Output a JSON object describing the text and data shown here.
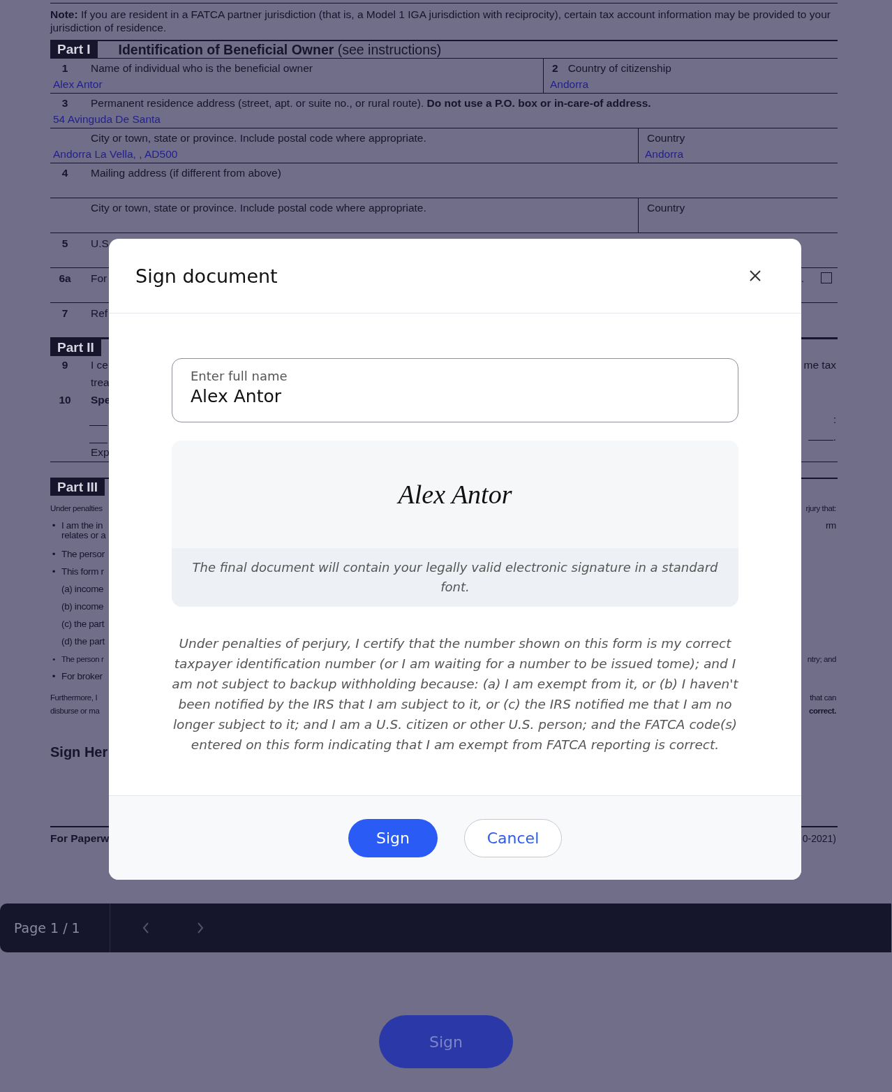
{
  "note": "**Note:** If you are resident in a FATCA partner jurisdiction (that is, a Model 1 IGA jurisdiction with reciprocity), certain tax account information may be provided to your jurisdiction of residence.",
  "part_one": {
    "label": "Part I",
    "title": "**Identification of Beneficial Owner** (see instructions)"
  },
  "rows": [
    {
      "kind": "split",
      "cells": [
        {
          "number": "1",
          "label": "Name of individual who is the beneficial owner",
          "value": "Alex Antor"
        },
        {
          "number": "2",
          "label": "Country of citizenship",
          "value": "Andorra"
        }
      ]
    },
    {
      "kind": "full",
      "cells": [
        {
          "number": "3",
          "label": "Permanent residence address (street, apt. or suite no., or rural route). **Do not use a P.O. box or in-care-of address.**",
          "value": "54 Avinguda De Santa"
        }
      ]
    },
    {
      "kind": "country",
      "cells": [
        {
          "label": "City or town, state or province. Include postal code where appropriate.",
          "value": "Andorra La Vella, , AD500"
        },
        {
          "label": "Country",
          "value": "Andorra"
        }
      ]
    },
    {
      "kind": "full",
      "cells": [
        {
          "number": "4",
          "label": "Mailing address (if different from above)"
        }
      ]
    },
    {
      "kind": "country",
      "cells": [
        {
          "label": "City or town, state or province. Include postal code where appropriate."
        },
        {
          "label": "Country"
        }
      ]
    }
  ],
  "lower_rows": [
    {
      "kind": "numbered",
      "number": "5",
      "left": "U.S"
    },
    {
      "kind": "numbered",
      "number": "6a",
      "left": "For",
      "right": ".",
      "checkbox": {
        "checked": false
      }
    },
    {
      "kind": "numbered",
      "number": "7",
      "left": "Ref"
    },
    {
      "kind": "part",
      "left": "Part II"
    },
    {
      "kind": "text",
      "number": "9",
      "left": "I ce",
      "right": "me tax"
    },
    {
      "kind": "text",
      "left": "trea"
    },
    {
      "kind": "bold",
      "number": "10",
      "left": "Spe"
    },
    {
      "kind": "blank",
      "right": ":"
    },
    {
      "kind": "blank-end",
      "right": "."
    },
    {
      "kind": "text-ruled",
      "left": "Exp"
    },
    {
      "kind": "part",
      "left": "Part III"
    },
    {
      "kind": "small",
      "left": "Under penalties",
      "right": "rjury that:"
    },
    {
      "kind": "bullet",
      "bullet": "•",
      "left": "I am the in",
      "right": "rm"
    },
    {
      "kind": "continuation",
      "left": "relates or a"
    },
    {
      "kind": "bullet",
      "bullet": "•",
      "left": "The persor"
    },
    {
      "kind": "bullet",
      "bullet": "•",
      "left": "This form r"
    },
    {
      "kind": "sub",
      "left": "(a) income"
    },
    {
      "kind": "sub",
      "left": "(b) income"
    },
    {
      "kind": "sub",
      "left": "(c) the part"
    },
    {
      "kind": "sub",
      "left": "(d) the part"
    },
    {
      "kind": "bullet-small",
      "bullet": "•",
      "left": "The person r",
      "right": "ntry; and"
    },
    {
      "kind": "bullet",
      "bullet": "•",
      "left": "For broker"
    },
    {
      "kind": "small",
      "left": "Furthermore, I",
      "right": "that can"
    },
    {
      "kind": "small-tight",
      "left": "disburse or ma",
      "right": "**correct.**"
    },
    {
      "kind": "heading",
      "left": "Sign Her"
    },
    {
      "kind": "footer",
      "left": "For Paperw",
      "right": "0-2021)"
    }
  ],
  "dialog": {
    "title": "Sign document",
    "name_field": {
      "label": "Enter full name",
      "value": "Alex Antor"
    },
    "signature_preview": "Alex Antor",
    "preview_note": "The final document will contain your legally valid electronic signature in a standard font.",
    "certification": "Under penalties of perjury, I certify that the number shown on this form is my correct taxpayer identification number (or I am waiting for a number to be issued tome); and I am not subject to backup withholding because: (a) I am exempt from it, or (b) I haven't been notified by the IRS that I am subject to it, or (c) the IRS notified me that I am no longer subject to it; and I am a U.S. citizen or other U.S. person; and the FATCA code(s) entered on this form indicating that I am exempt from FATCA reporting is correct.",
    "buttons": [
      {
        "kind": "primary",
        "label": "Sign"
      },
      {
        "kind": "secondary",
        "label": "Cancel"
      }
    ]
  },
  "pager": {
    "page_label": "Page 1 / 1"
  },
  "sign_button": {
    "label": "Sign"
  }
}
